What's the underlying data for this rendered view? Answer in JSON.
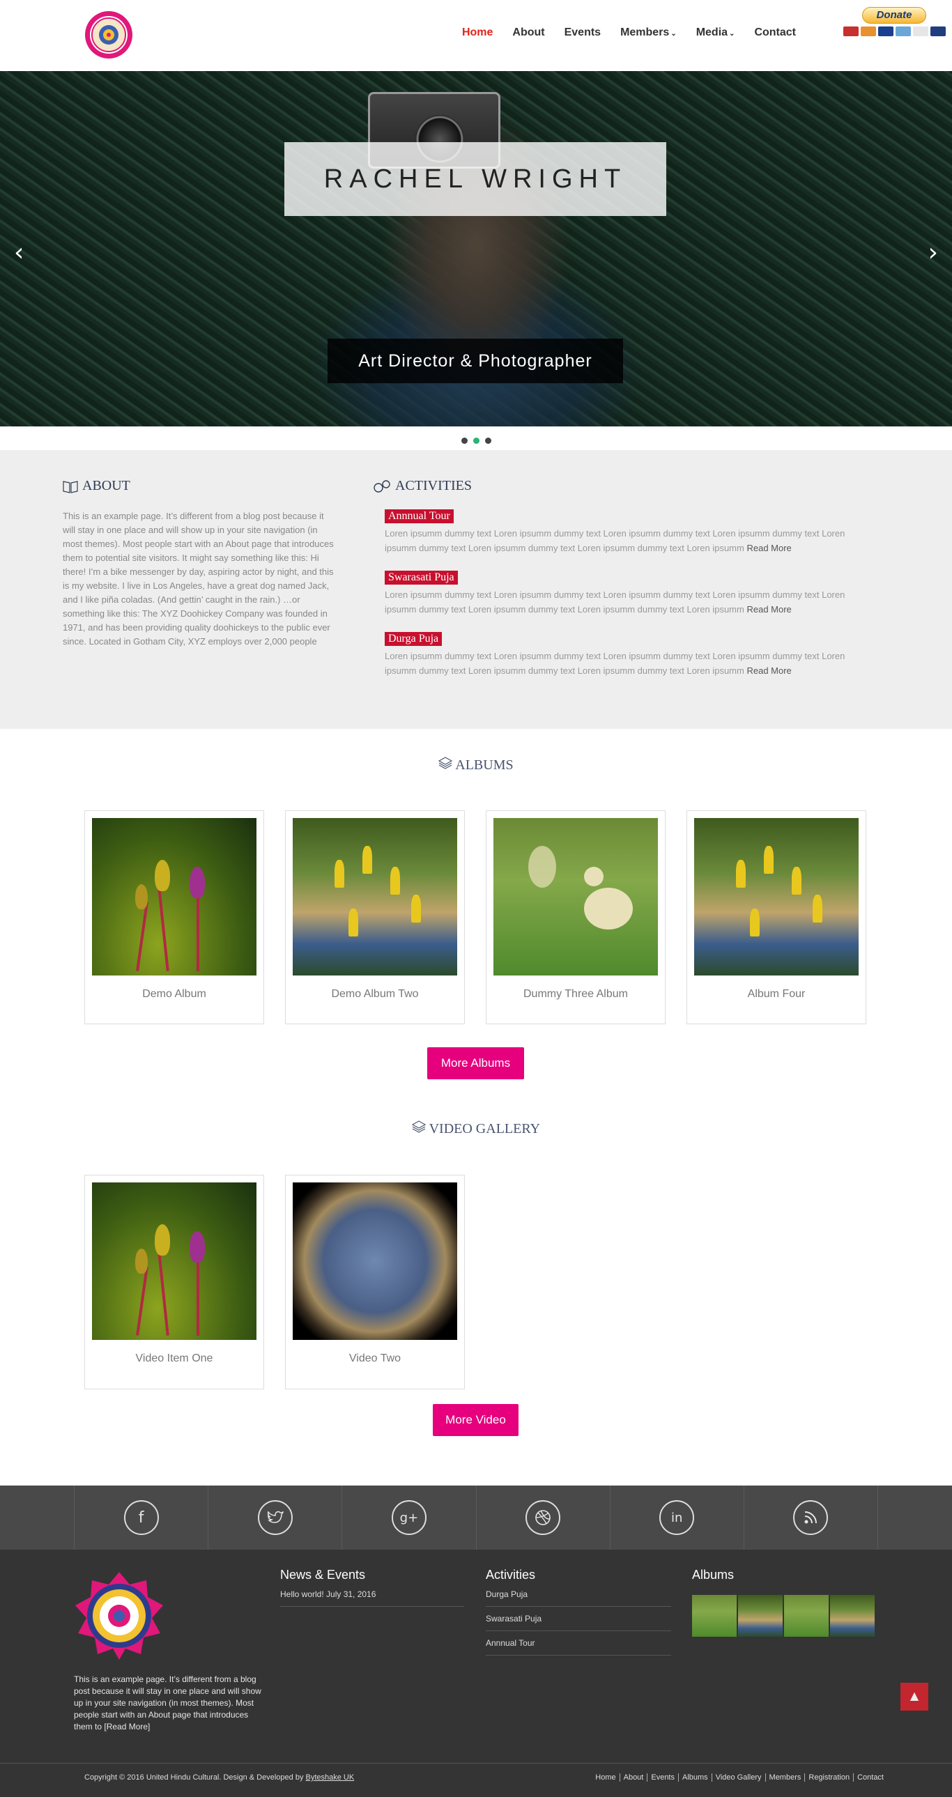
{
  "header": {
    "nav": [
      {
        "label": "Home",
        "active": true
      },
      {
        "label": "About"
      },
      {
        "label": "Events"
      },
      {
        "label": "Members",
        "dropdown": true
      },
      {
        "label": "Media",
        "dropdown": true
      },
      {
        "label": "Contact"
      }
    ],
    "donate_label": "Donate"
  },
  "hero": {
    "title": "RACHEL WRIGHT",
    "subtitle": "Art Director & Photographer",
    "slides": 3,
    "active_slide": 2
  },
  "about": {
    "heading": "ABOUT",
    "text": "This is an example page. It’s different from a blog post because it will stay in one place and will show up in your site navigation (in most themes). Most people start with an About page that introduces them to potential site visitors. It might say something like this: Hi there! I’m a bike messenger by day, aspiring actor by night, and this is my website. I live in Los Angeles, have a great dog named Jack, and I like piña coladas. (And gettin’ caught in the rain.) …or something like this: The XYZ Doohickey Company was founded in 1971, and has been providing quality doohickeys to the public ever since. Located in Gotham City, XYZ employs over 2,000 people"
  },
  "activities": {
    "heading": "ACTIVITIES",
    "items": [
      {
        "title": "Annnual Tour",
        "text": "Loren ipsumm dummy text Loren ipsumm dummy text Loren ipsumm dummy text Loren ipsumm dummy text Loren ipsumm dummy text Loren ipsumm dummy text Loren ipsumm dummy text Loren ipsumm",
        "more": "Read More"
      },
      {
        "title": "Swarasati Puja",
        "text": "Loren ipsumm dummy text Loren ipsumm dummy text Loren ipsumm dummy text Loren ipsumm dummy text Loren ipsumm dummy text Loren ipsumm dummy text Loren ipsumm dummy text Loren ipsumm",
        "more": "Read More"
      },
      {
        "title": "Durga Puja",
        "text": "Loren ipsumm dummy text Loren ipsumm dummy text Loren ipsumm dummy text Loren ipsumm dummy text Loren ipsumm dummy text Loren ipsumm dummy text Loren ipsumm dummy text Loren ipsumm",
        "more": "Read More"
      }
    ]
  },
  "albums": {
    "heading": "ALBUMS",
    "items": [
      "Demo Album",
      "Demo Album Two",
      "Dummy Three Album",
      "Album Four"
    ],
    "more_label": "More Albums"
  },
  "videos": {
    "heading": "VIDEO GALLERY",
    "items": [
      "Video Item One",
      "Video Two"
    ],
    "more_label": "More Video"
  },
  "social": [
    "facebook-icon",
    "twitter-icon",
    "google-plus-icon",
    "dribbble-icon",
    "linkedin-icon",
    "rss-icon"
  ],
  "footer": {
    "about_text": "This is an example page. It’s different from a blog post because it will stay in one place and will show up in your site navigation (in most themes). Most people start with an About page that introduces them to [Read More]",
    "news_title": "News & Events",
    "news_items": [
      "Hello world! July 31, 2016"
    ],
    "activities_title": "Activities",
    "activities_items": [
      "Durga Puja",
      "Swarasati Puja",
      "Annnual Tour"
    ],
    "albums_title": "Albums",
    "copyright_prefix": "Copyright © 2016 United Hindu Cultural. Design & Developed by ",
    "copyright_link": "Byteshake UK",
    "nav": [
      "Home",
      "About",
      "Events",
      "Albums",
      "Video Gallery",
      "Members",
      "Registration",
      "Contact"
    ]
  },
  "colors": {
    "accent_pink": "#e6007e",
    "nav_active": "#e2231a",
    "activity_tag": "#c8102e",
    "footer_bg": "#343434"
  }
}
